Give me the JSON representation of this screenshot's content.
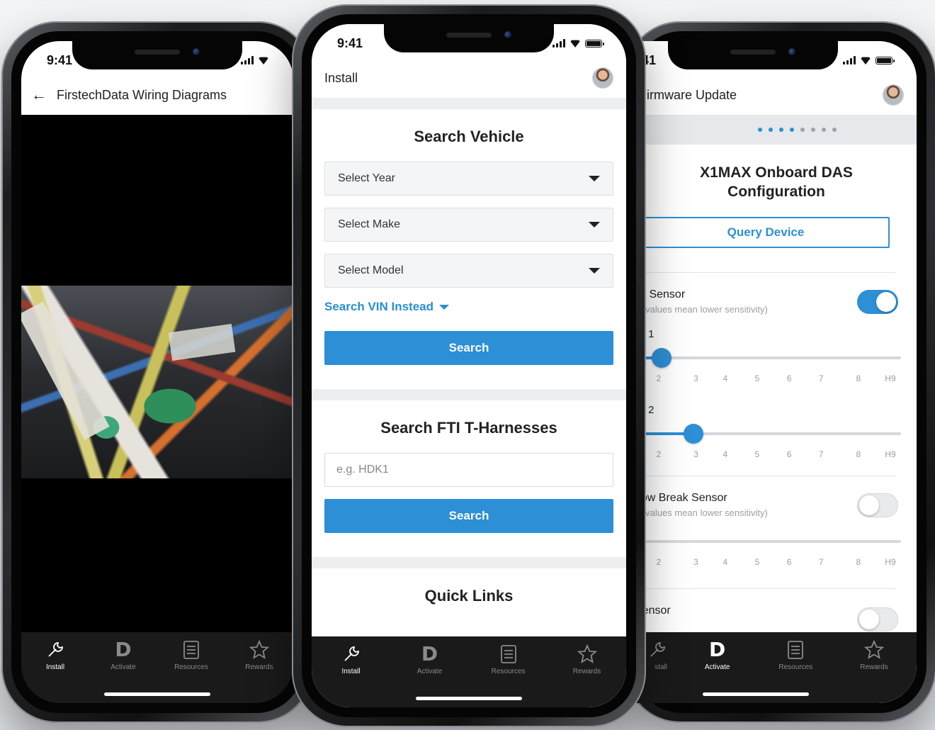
{
  "status_time": "9:41",
  "tabs": [
    {
      "label": "Install",
      "icon": "wrench-icon"
    },
    {
      "label": "Activate",
      "icon": "d-logo-icon"
    },
    {
      "label": "Resources",
      "icon": "list-icon"
    },
    {
      "label": "Rewards",
      "icon": "star-icon"
    }
  ],
  "left": {
    "title": "FirstechData Wiring Diagrams",
    "active_tab": "Install"
  },
  "center": {
    "header_title": "Install",
    "search_vehicle": {
      "heading": "Search Vehicle",
      "year_placeholder": "Select Year",
      "make_placeholder": "Select Make",
      "model_placeholder": "Select Model",
      "vin_link": "Search VIN Instead",
      "button": "Search"
    },
    "harness": {
      "heading": "Search FTI T-Harnesses",
      "placeholder": "e.g. HDK1",
      "button": "Search"
    },
    "quick_links": {
      "heading": "Quick Links"
    }
  },
  "right": {
    "status_time": ":41",
    "header_title": "Firmware Update",
    "progress": {
      "total_steps": 8,
      "current_step": 4
    },
    "config_title_line1": "X1MAX Onboard DAS",
    "config_title_line2": "Configuration",
    "query_button": "Query Device",
    "shock_sensor": {
      "name": "ck Sensor",
      "hint": "er values mean lower sensitivity)",
      "enabled": true
    },
    "shock1": {
      "label": "ck 1",
      "level_fraction": 0.1
    },
    "shock2": {
      "label": "ck 2",
      "level_fraction": 0.22
    },
    "window_sensor": {
      "name": "dow Break Sensor",
      "hint": "er values mean lower sensitivity)",
      "enabled": false
    },
    "window_slider": {
      "level_fraction": 0
    },
    "last_sensor": {
      "name": "Sensor"
    },
    "tick_labels": [
      "2",
      "3",
      "4",
      "5",
      "6",
      "7",
      "8",
      "H9"
    ],
    "tabs_visible": [
      "stall",
      "Activate",
      "Resources",
      "Rewards"
    ],
    "active_tab": "Activate"
  },
  "colors": {
    "accent": "#2d8fd5",
    "tabbar": "#1a1a1a"
  }
}
